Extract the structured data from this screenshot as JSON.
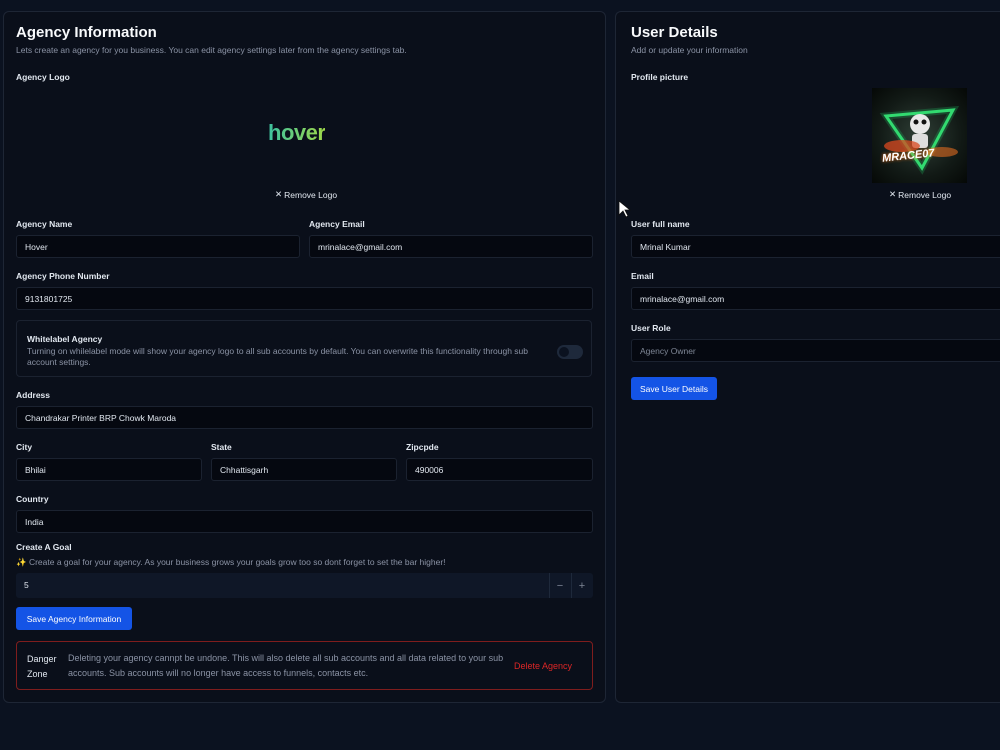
{
  "agency": {
    "title": "Agency Information",
    "subtitle": "Lets create an agency for you business. You can edit agency settings later from the agency settings tab.",
    "logo_label": "Agency Logo",
    "logo_text": "hover",
    "remove_logo": "Remove Logo",
    "name_label": "Agency Name",
    "name_value": "Hover",
    "email_label": "Agency Email",
    "email_value": "mrinalace@gmail.com",
    "phone_label": "Agency Phone Number",
    "phone_value": "9131801725",
    "whitelabel_title": "Whitelabel Agency",
    "whitelabel_desc": "Turning on whilelabel mode will show your agency logo to all sub accounts by default. You can overwrite this functionality through sub account settings.",
    "whitelabel_on": false,
    "address_label": "Address",
    "address_value": "Chandrakar Printer BRP Chowk Maroda",
    "city_label": "City",
    "city_value": "Bhilai",
    "state_label": "State",
    "state_value": "Chhattisgarh",
    "zip_label": "Zipcpde",
    "zip_value": "490006",
    "country_label": "Country",
    "country_value": "India",
    "goal_label": "Create A Goal",
    "goal_desc": "✨ Create a goal for your agency. As your business grows your goals grow too so dont forget to set the bar higher!",
    "goal_value": "5",
    "minus": "−",
    "plus": "+",
    "save_label": "Save Agency Information",
    "danger_title": "Danger Zone",
    "danger_desc": "Deleting your agency cannpt be undone. This will also delete all sub accounts and all data related to your sub accounts. Sub accounts will no longer have access to funnels, contacts etc.",
    "delete_label": "Delete Agency"
  },
  "user": {
    "title": "User Details",
    "subtitle": "Add or update your information",
    "picture_label": "Profile picture",
    "avatar_text": "MRACE07",
    "remove_logo": "Remove Logo",
    "name_label": "User full name",
    "name_value": "Mrinal Kumar",
    "email_label": "Email",
    "email_value": "mrinalace@gmail.com",
    "role_label": "User Role",
    "role_value": "Agency Owner",
    "save_label": "Save User Details"
  },
  "icons": {
    "close": "close-icon",
    "cursor": "mouse-pointer-icon",
    "sparkle": "sparkle-icon"
  },
  "colors": {
    "accent": "#1454e6",
    "danger": "#dc2626",
    "background": "#0b1220"
  }
}
